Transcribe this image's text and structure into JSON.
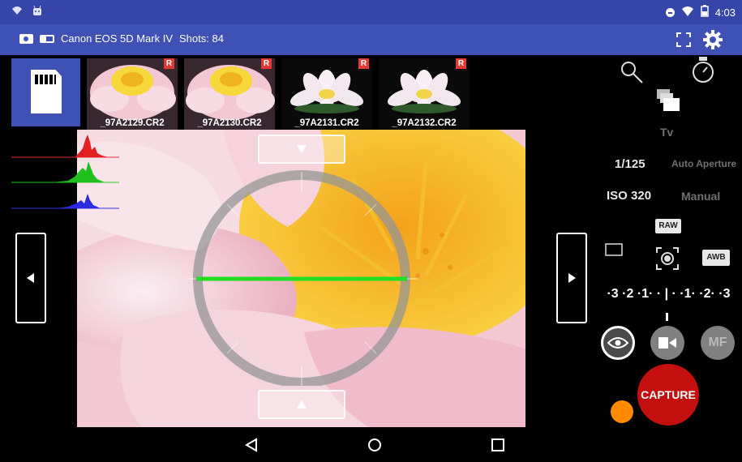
{
  "status_bar": {
    "time": "4:03"
  },
  "app_bar": {
    "camera_name": "Canon EOS 5D Mark IV",
    "shots_label": "Shots: 84"
  },
  "thumbnails": [
    {
      "filename": "_97A2129.CR2",
      "badge": "R"
    },
    {
      "filename": "_97A2130.CR2",
      "badge": "R"
    },
    {
      "filename": "_97A2131.CR2",
      "badge": "R"
    },
    {
      "filename": "_97A2132.CR2",
      "badge": "R"
    }
  ],
  "right_panel": {
    "mode": "Tv",
    "shutter": "1/125",
    "aperture": "Auto Aperture",
    "iso": "ISO 320",
    "iso_mode": "Manual",
    "raw_badge": "RAW",
    "awb_badge": "AWB",
    "ev_scale": "·3 ·2 ·1· · | · ·1· ·2· ·3",
    "mf_label": "MF",
    "capture_label": "CAPTURE"
  },
  "colors": {
    "status_bar": "#3546a8",
    "app_bar": "#3f51b5",
    "capture": "#c40f0f",
    "level_line": "#22dd22",
    "orange": "#ff8a00"
  },
  "icons": [
    "wifi-icon",
    "android-icon",
    "signal-icon",
    "battery-icon",
    "camera-icon",
    "fullscreen-icon",
    "settings-icon",
    "sd-card-icon",
    "search-icon",
    "timer-icon",
    "bracket-icon",
    "aspect-icon",
    "metering-icon",
    "eye-icon",
    "video-icon",
    "back-icon",
    "home-icon",
    "recents-icon"
  ]
}
